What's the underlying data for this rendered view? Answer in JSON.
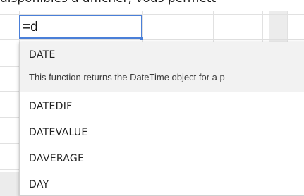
{
  "background_text": "disponibles à afficher, vous permett",
  "cell": {
    "value": "=d"
  },
  "autocomplete": {
    "selected": {
      "name": "DATE",
      "description": "This function returns the DateTime object for a p"
    },
    "items": [
      {
        "name": "DATEDIF"
      },
      {
        "name": "DATEVALUE"
      },
      {
        "name": "DAVERAGE"
      },
      {
        "name": "DAY"
      }
    ]
  },
  "colors": {
    "selection_border": "#4a7fd8",
    "highlight_row": "#f2f2f2",
    "grid_line": "#e1e1e1"
  }
}
